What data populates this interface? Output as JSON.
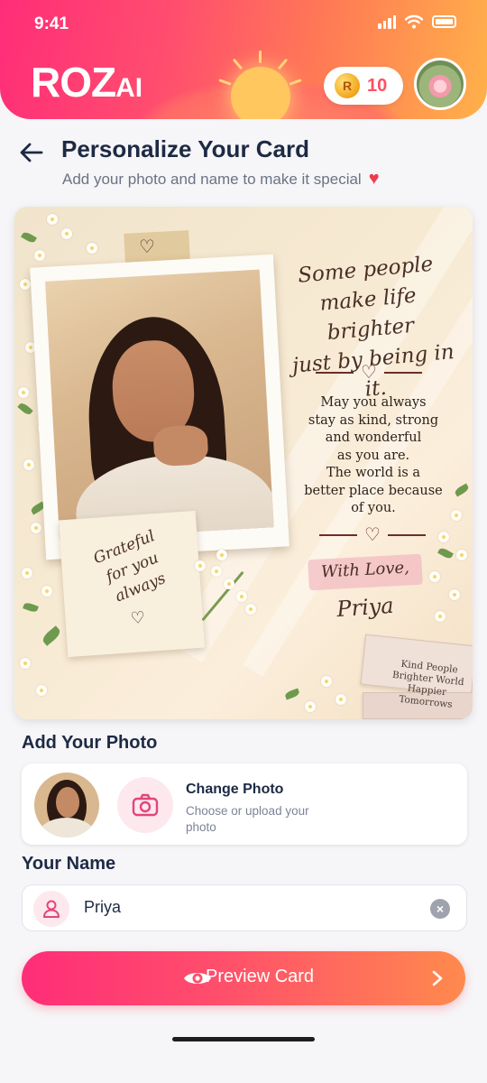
{
  "status_bar": {
    "time": "9:41"
  },
  "header": {
    "logo_main": "ROZ",
    "logo_suffix": "AI",
    "coin_symbol": "R",
    "coin_count": "10"
  },
  "page": {
    "title": "Personalize Your Card",
    "subtitle": "Add your photo and name to make it special"
  },
  "card": {
    "note_lines": [
      "Grateful",
      "for you",
      "always"
    ],
    "quote_lines": [
      "Some people",
      "make life brighter",
      "just by being in it."
    ],
    "message_lines": [
      "May you always",
      "stay as kind, strong",
      "and wonderful",
      "as you are.",
      "The world is a",
      "better place because",
      "of you."
    ],
    "signoff": "With Love,",
    "signature": "Priya",
    "book_lines": [
      "Kind People",
      "Brighter World",
      "Happier Tomorrows"
    ]
  },
  "photo_section": {
    "label": "Add Your Photo",
    "change_title": "Change Photo",
    "change_subtitle": "Choose or upload your photo"
  },
  "name_section": {
    "label": "Your Name",
    "value": "Priya"
  },
  "cta": {
    "label": "Preview Card"
  },
  "colors": {
    "brand_pink": "#ff2d78",
    "brand_orange": "#ffb14a",
    "title_navy": "#1d2a44",
    "accent_heart": "#ef3b4f"
  },
  "icons": [
    "back-arrow-icon",
    "heart-icon",
    "coin-icon",
    "camera-icon",
    "user-icon",
    "clear-icon",
    "eye-icon",
    "chevron-right-icon"
  ]
}
